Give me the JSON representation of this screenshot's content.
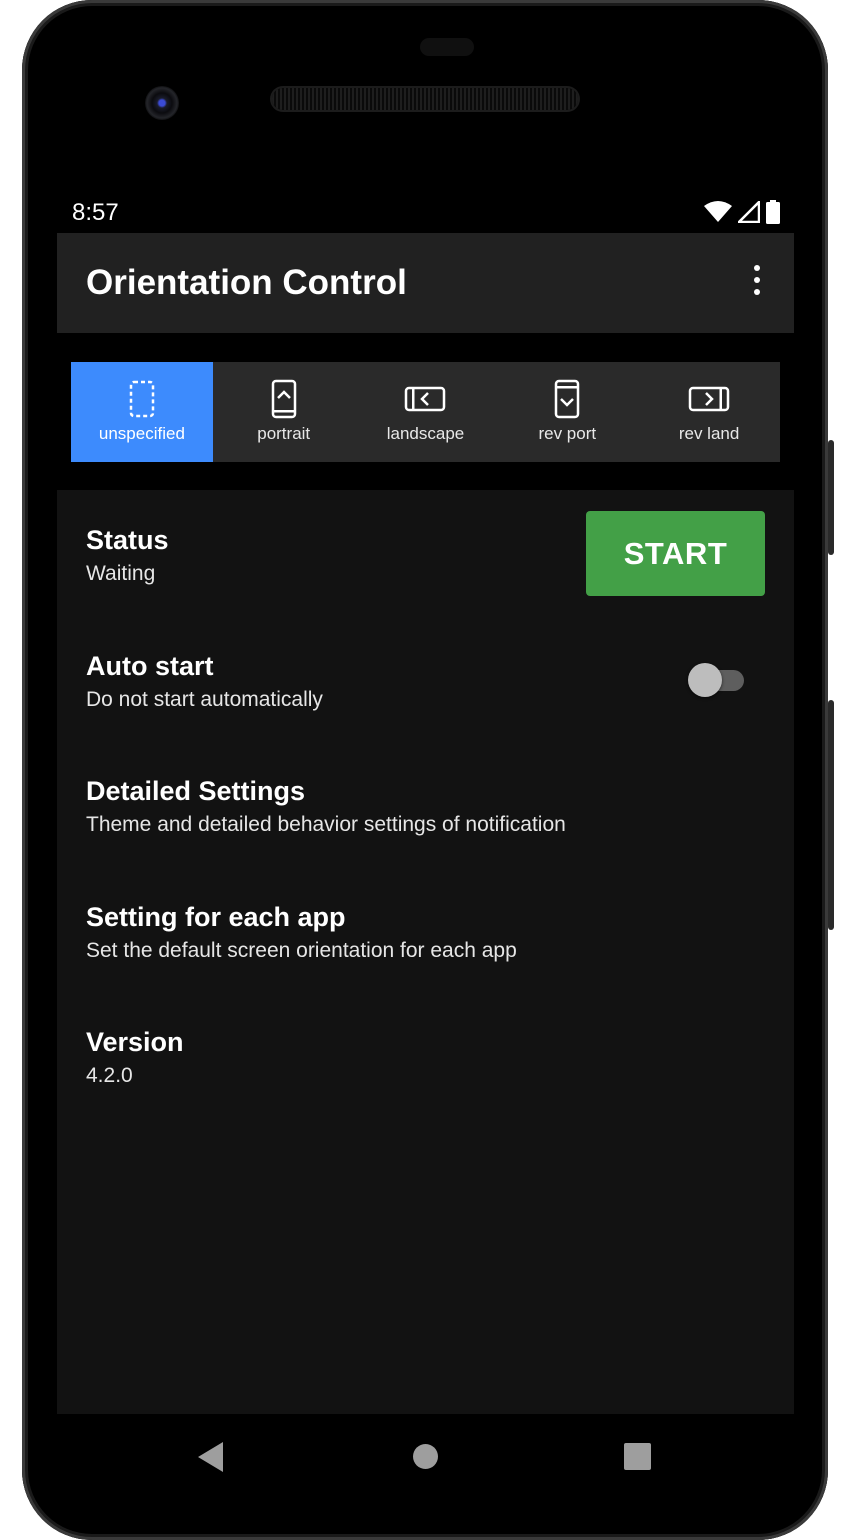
{
  "status_bar": {
    "time": "8:57",
    "icons": [
      "wifi-icon",
      "cell-signal-icon",
      "battery-icon"
    ]
  },
  "app_bar": {
    "title": "Orientation Control",
    "menu_icon": "more-vert-icon"
  },
  "orientation_tabs": {
    "selected": "unspecified",
    "items": [
      {
        "label": "unspecified",
        "icon": "orientation-unspecified-icon"
      },
      {
        "label": "portrait",
        "icon": "orientation-portrait-icon"
      },
      {
        "label": "landscape",
        "icon": "orientation-landscape-icon"
      },
      {
        "label": "rev port",
        "icon": "orientation-reverse-portrait-icon"
      },
      {
        "label": "rev land",
        "icon": "orientation-reverse-landscape-icon"
      }
    ]
  },
  "settings": {
    "status": {
      "title": "Status",
      "value": "Waiting",
      "button_label": "START"
    },
    "auto_start": {
      "title": "Auto start",
      "summary": "Do not start automatically",
      "enabled": false
    },
    "detailed_settings": {
      "title": "Detailed Settings",
      "summary": "Theme and detailed behavior settings of notification"
    },
    "per_app": {
      "title": "Setting for each app",
      "summary": "Set the default screen orientation for each app"
    },
    "version": {
      "title": "Version",
      "value": "4.2.0"
    }
  },
  "colors": {
    "app_bar": "#212121",
    "tab_strip": "#2a2a2a",
    "tab_selected": "#3d8bfd",
    "start_button": "#43a047",
    "background": "#121212"
  },
  "nav_bar": {
    "icons": [
      "back-icon",
      "home-icon",
      "recents-icon"
    ]
  }
}
